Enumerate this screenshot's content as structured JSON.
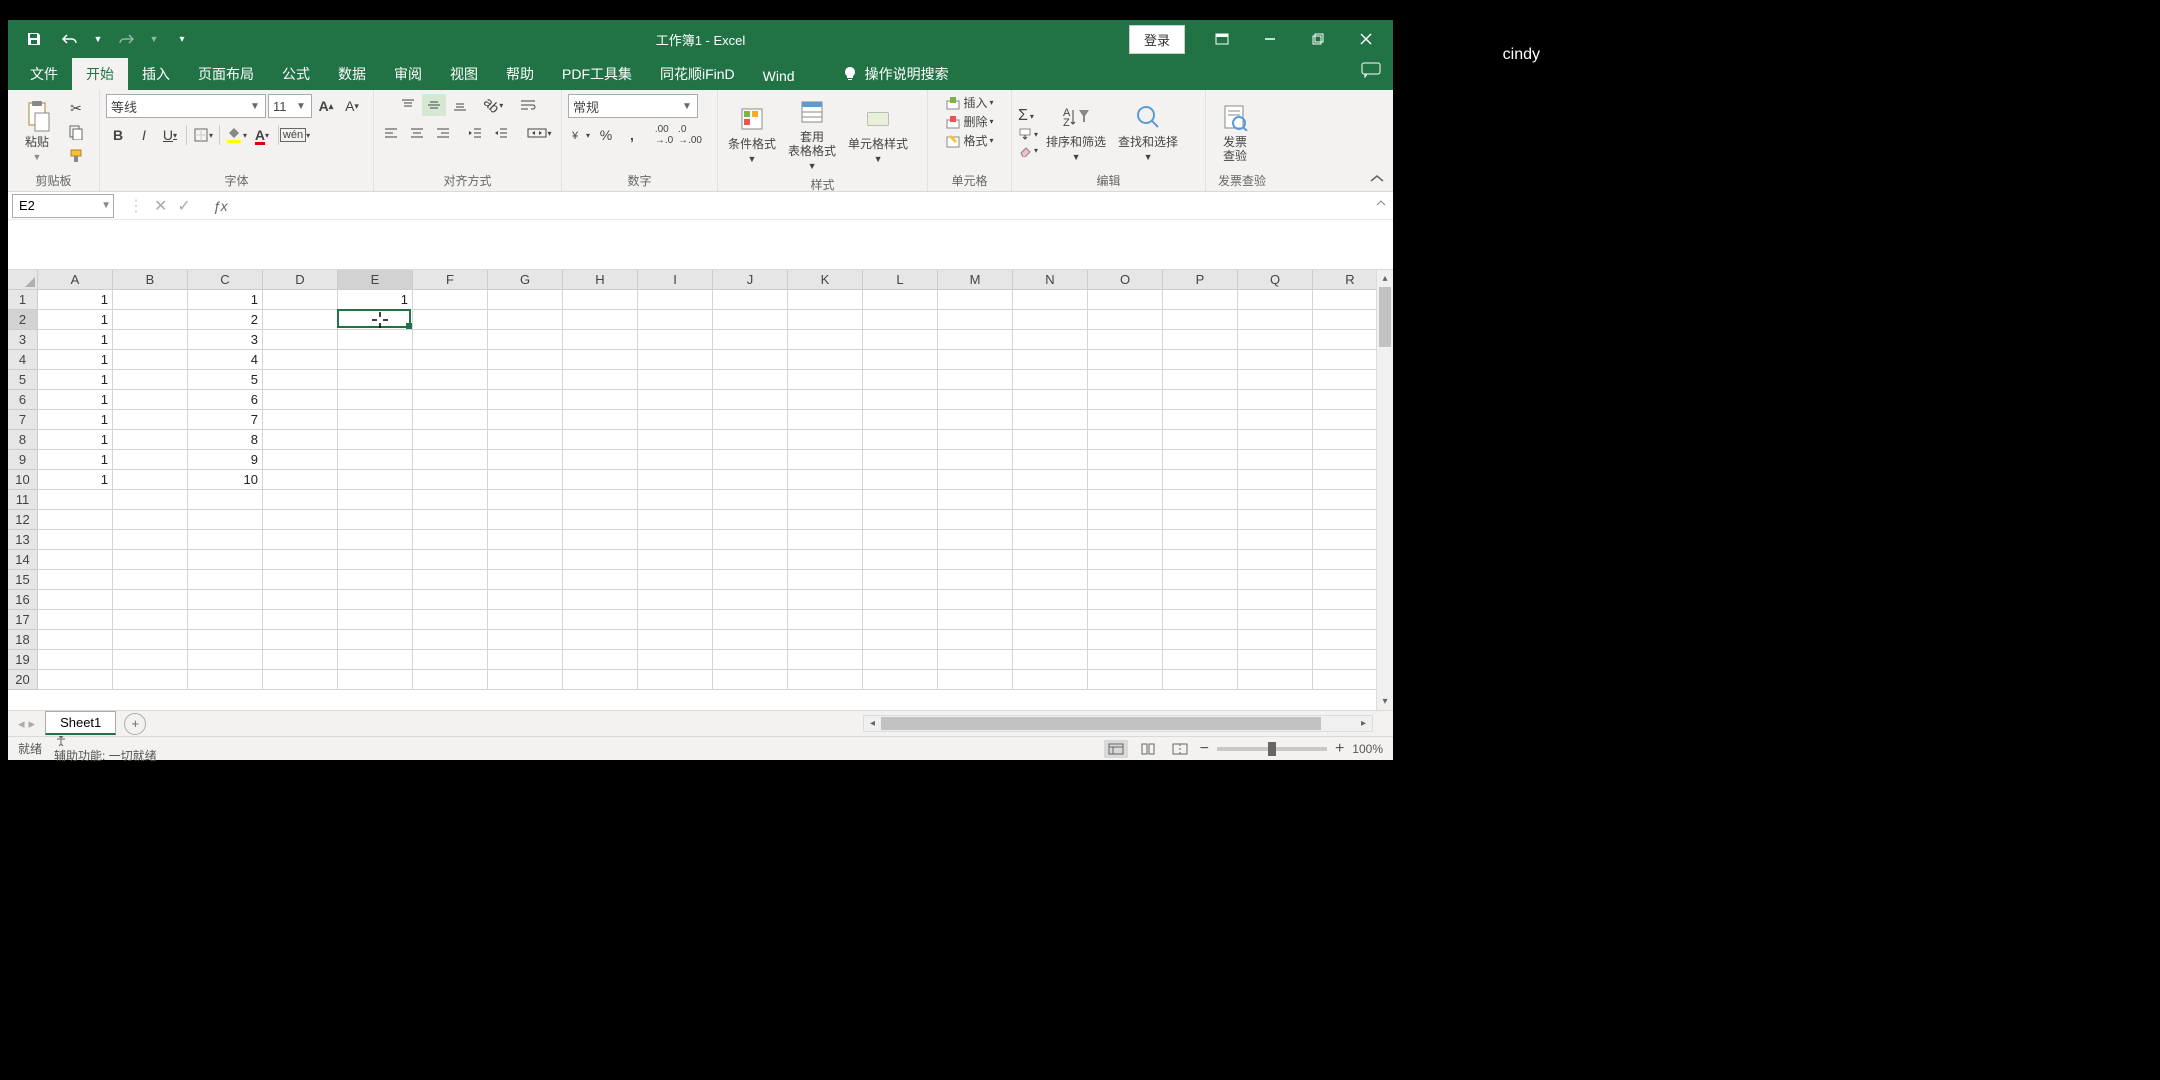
{
  "side_label": "cindy",
  "title": "工作簿1 - Excel",
  "login_button": "登录",
  "tabs": {
    "file": "文件",
    "home": "开始",
    "insert": "插入",
    "page_layout": "页面布局",
    "formulas": "公式",
    "data": "数据",
    "review": "审阅",
    "view": "视图",
    "help": "帮助",
    "pdf": "PDF工具集",
    "ths": "同花顺iFinD",
    "wind": "Wind",
    "tell_me": "操作说明搜索"
  },
  "ribbon": {
    "clipboard": {
      "paste": "粘贴",
      "label": "剪贴板"
    },
    "font": {
      "name": "等线",
      "size": "11",
      "label": "字体"
    },
    "alignment": {
      "label": "对齐方式"
    },
    "number": {
      "format": "常规",
      "label": "数字"
    },
    "styles": {
      "conditional": "条件格式",
      "table": "套用\n表格格式",
      "cell": "单元格样式",
      "label": "样式"
    },
    "cells": {
      "insert": "插入",
      "delete": "删除",
      "format": "格式",
      "label": "单元格"
    },
    "editing": {
      "sort": "排序和筛选",
      "find": "查找和选择",
      "label": "编辑"
    },
    "invoice": {
      "check": "发票\n查验",
      "label": "发票查验"
    }
  },
  "namebox": "E2",
  "formula": "",
  "columns": [
    "A",
    "B",
    "C",
    "D",
    "E",
    "F",
    "G",
    "H",
    "I",
    "J",
    "K",
    "L",
    "M",
    "N",
    "O",
    "P",
    "Q",
    "R"
  ],
  "row_count": 20,
  "selected_cell": {
    "col": "E",
    "row": 2,
    "col_index": 4,
    "row_index": 1
  },
  "cell_data": {
    "A": {
      "1": "1",
      "2": "1",
      "3": "1",
      "4": "1",
      "5": "1",
      "6": "1",
      "7": "1",
      "8": "1",
      "9": "1",
      "10": "1"
    },
    "C": {
      "1": "1",
      "2": "2",
      "3": "3",
      "4": "4",
      "5": "5",
      "6": "6",
      "7": "7",
      "8": "8",
      "9": "9",
      "10": "10"
    },
    "E": {
      "1": "1"
    }
  },
  "sheet_tab": "Sheet1",
  "status": {
    "ready": "就绪",
    "accessibility": "辅助功能: 一切就绪",
    "zoom": "100%"
  }
}
